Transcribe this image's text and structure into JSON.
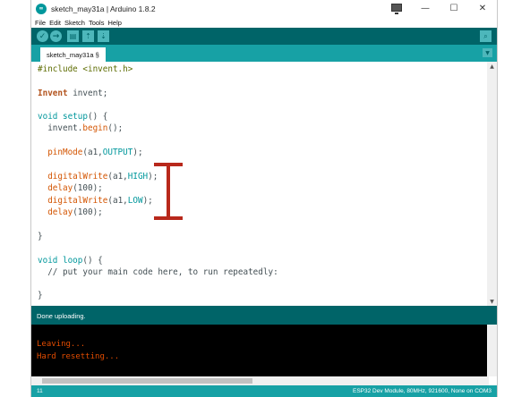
{
  "window": {
    "title": "sketch_may31a | Arduino 1.8.2",
    "controls": {
      "minimize": "—",
      "maximize": "☐",
      "close": "✕"
    }
  },
  "menu": [
    "File",
    "Edit",
    "Sketch",
    "Tools",
    "Help"
  ],
  "toolbar": {
    "verify_icon": "✓",
    "upload_icon": "→",
    "new_icon": "▤",
    "open_icon": "⇡",
    "save_icon": "⇣",
    "serial_monitor_icon": "⌕"
  },
  "tabs": [
    {
      "label": "sketch_may31a §"
    }
  ],
  "tab_menu_icon": "▼",
  "code": {
    "l1": "#include <invent.h>",
    "l2a": "Invent",
    "l2b": " invent;",
    "l3a": "void",
    "l3b": " setup",
    "l3c": "() {",
    "l4a": "  invent.",
    "l4b": "begin",
    "l4c": "();",
    "l5a": "  pinMode",
    "l5b": "(a1,",
    "l5c": "OUTPUT",
    "l5d": ");",
    "l6a": "  digitalWrite",
    "l6b": "(a1,",
    "l6c": "HIGH",
    "l6d": ");",
    "l7a": "  delay",
    "l7b": "(100);",
    "l8a": "  digitalWrite",
    "l8b": "(a1,",
    "l8c": "LOW",
    "l8d": ");",
    "l9a": "  delay",
    "l9b": "(100);",
    "l10": "}",
    "l11a": "void",
    "l11b": " loop",
    "l11c": "() {",
    "l12": "  // put your main code here, to run repeatedly:",
    "l13": "}"
  },
  "status": {
    "message": "Done uploading."
  },
  "console": {
    "line1": "Leaving...",
    "line2": "Hard resetting..."
  },
  "footer": {
    "line_number": "11",
    "board": "ESP32 Dev Module, 80MHz, 921600, None on COM3"
  },
  "colors": {
    "toolbar": "#006468",
    "tabbar": "#17a1a5",
    "marker": "#b8281b"
  }
}
